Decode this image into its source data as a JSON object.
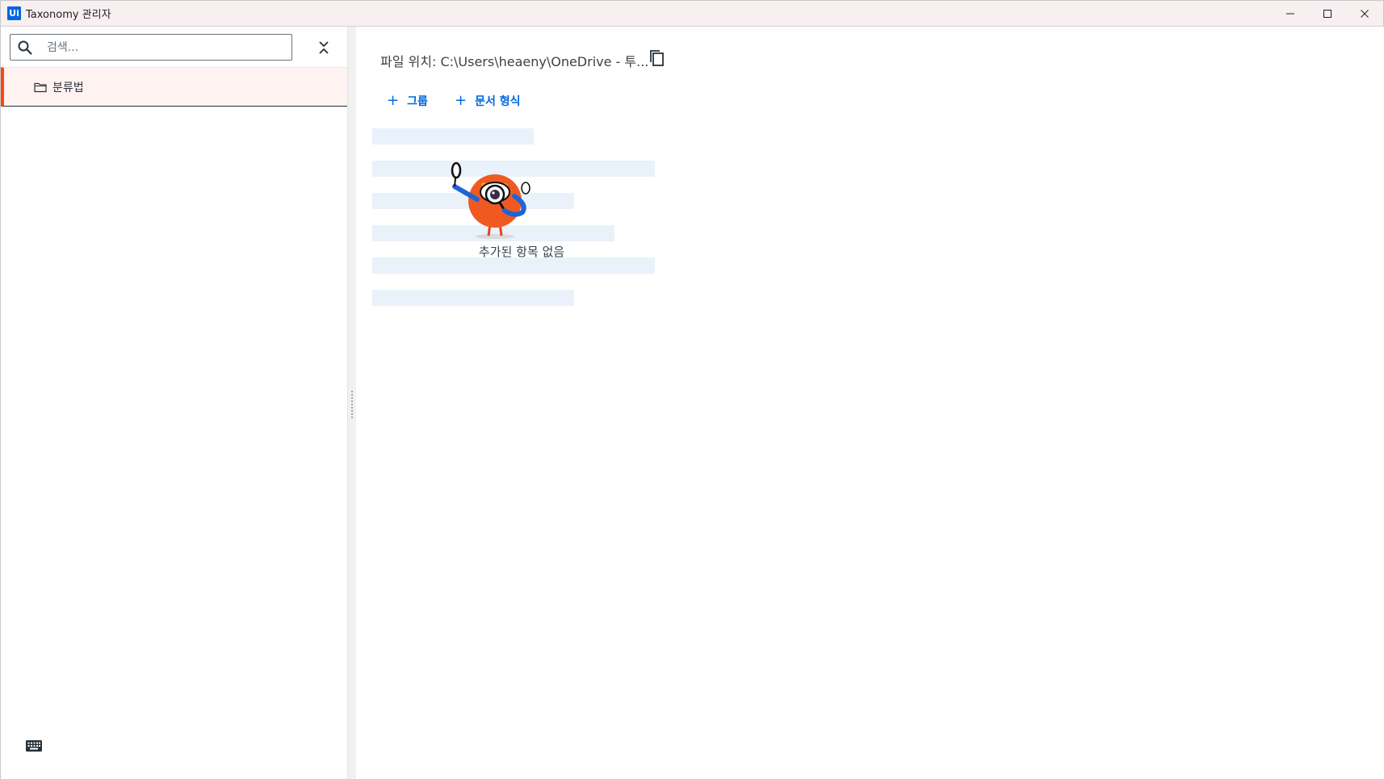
{
  "window": {
    "app_logo": "Ui",
    "title": "Taxonomy 관리자",
    "controls": [
      "minimize-icon",
      "maximize-icon",
      "close-icon"
    ]
  },
  "sidebar": {
    "search": {
      "placeholder": "검색...",
      "value": ""
    },
    "tree": [
      {
        "label": "분류법",
        "icon": "folder-icon",
        "selected": true
      }
    ]
  },
  "main": {
    "file_path": "파일 위치: C:\\Users\\heaeny\\OneDrive - 투...",
    "actions": {
      "add_group": "그룹",
      "add_doc_type": "문서 형식"
    },
    "empty_state": "추가된 항목 없음"
  },
  "colors": {
    "accent": "#0067df",
    "selection_border": "#fa4616",
    "selection_bg": "#fff3f1",
    "titlebar_bg": "#f8eff0",
    "skeleton": "#e9f1fa"
  }
}
